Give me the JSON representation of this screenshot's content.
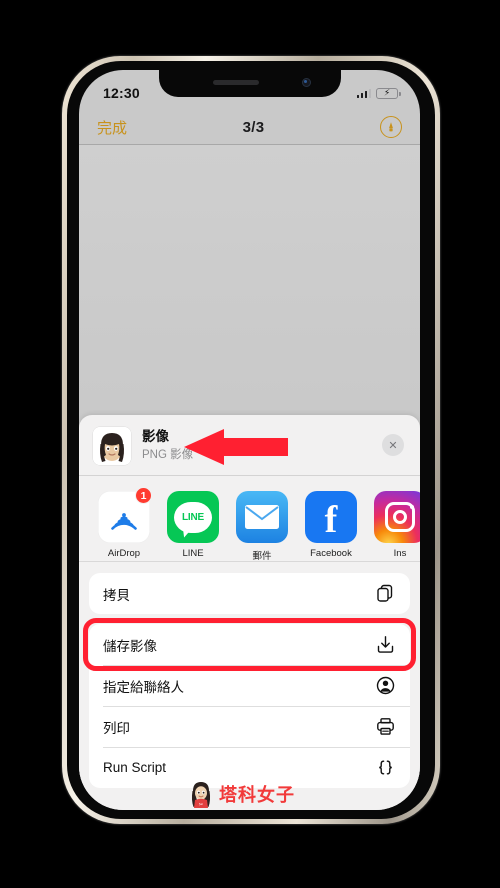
{
  "status_bar": {
    "time": "12:30",
    "signal_icon": "cellular-signal-icon",
    "signal_bars_filled": 3,
    "battery_icon": "battery-charging-icon",
    "battery_charging": true
  },
  "nav_bar": {
    "done_label": "完成",
    "title": "3/3",
    "markup_icon": "markup-pen-icon"
  },
  "photo": {
    "alt_name": "memoji-photo"
  },
  "share_sheet": {
    "document": {
      "title": "影像",
      "subtitle": "PNG 影像",
      "thumbnail_icon": "memoji-thumbnail"
    },
    "close_label": "✕",
    "apps": [
      {
        "label": "AirDrop",
        "icon": "airdrop-icon",
        "badge": "1"
      },
      {
        "label": "LINE",
        "icon": "line-icon",
        "badge": ""
      },
      {
        "label": "郵件",
        "icon": "mail-icon",
        "badge": ""
      },
      {
        "label": "Facebook",
        "icon": "facebook-icon",
        "badge": ""
      },
      {
        "label": "Ins",
        "icon": "instagram-icon",
        "badge": ""
      }
    ],
    "actions_group_1": [
      {
        "label": "拷貝",
        "icon": "copy-icon",
        "highlighted": false
      }
    ],
    "actions_group_2": [
      {
        "label": "儲存影像",
        "icon": "save-image-icon",
        "highlighted": true
      },
      {
        "label": "指定給聯絡人",
        "icon": "assign-contact-icon",
        "highlighted": false
      },
      {
        "label": "列印",
        "icon": "print-icon",
        "highlighted": false
      },
      {
        "label": "Run Script",
        "icon": "run-script-icon",
        "highlighted": false
      }
    ]
  },
  "annotations": {
    "arrow_icon": "red-left-arrow",
    "arrow_color": "#ff2031",
    "highlight_color": "#ff2031"
  },
  "watermark": {
    "text": "塔科女子",
    "logo_icon": "tarkwoman-logo-icon",
    "color": "#f23a3a"
  }
}
